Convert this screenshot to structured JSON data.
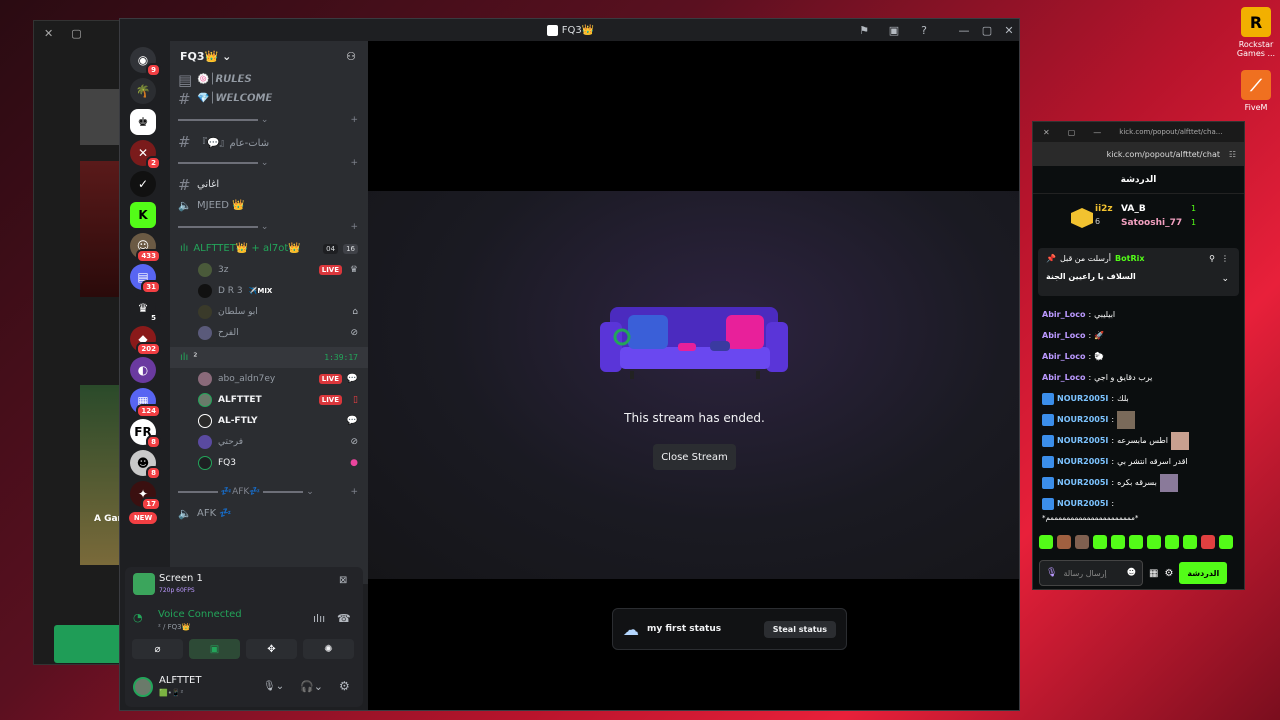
{
  "discord": {
    "window_title": "FQ3👑",
    "server_name": "FQ3👑",
    "guild_badges": [
      "9",
      "",
      "",
      "2",
      "",
      "",
      "433",
      "31",
      "5",
      "202",
      "",
      "124",
      "8",
      "8",
      "17"
    ],
    "new_badge": "NEW",
    "channels_top": [
      {
        "icon": "#",
        "label": "🍥│𝙍𝙐𝙇𝙀𝙎"
      },
      {
        "icon": "#",
        "label": "💎│𝙒𝙀𝙇𝘾𝙊𝙈𝙀"
      }
    ],
    "text_channel_1": "『💬』شات-عام",
    "text_channel_2": "اغاني",
    "voice_channel_mjeed": "MJEED 👑",
    "voice_channel_main": "ALFTTET👑 + al7ot👑",
    "voice_main_counts": [
      "04",
      "16"
    ],
    "voice_main_members": [
      {
        "name": "3z",
        "live": "LIVE"
      },
      {
        "name": "D R 3",
        "tag": "✈️MIX"
      },
      {
        "name": "ابو سلطان"
      },
      {
        "name": "الفرح"
      }
    ],
    "voice_channel_2": "²",
    "voice_2_timer": "1:39:17",
    "voice_2_members": [
      {
        "name": "abo_aldn7ey",
        "live": "LIVE"
      },
      {
        "name": "ALFTTET",
        "live": "LIVE"
      },
      {
        "name": "AL-FTLY"
      },
      {
        "name": "فرحتي"
      },
      {
        "name": "FQ3"
      }
    ],
    "afk_category": "💤AFK💤",
    "afk_channel": "AFK 💤",
    "screen_title": "Screen 1",
    "screen_quality": "720p 60FPS",
    "voice_status": "Voice Connected",
    "voice_location": "² / FQ3👑",
    "username": "ALFTTET",
    "user_status_line": "🟩•📱²",
    "stream_message": "This stream has ended.",
    "close_stream_label": "Close Stream",
    "popup_status": "my first status",
    "steal_status_label": "Steal status"
  },
  "kick": {
    "window_url_short": "kick.com/popout/alfttet/cha...",
    "url": "kick.com/popout/alfttet/chat",
    "header_title": "الدردشة",
    "leaderboard": [
      {
        "name": "ii2z",
        "count": "6"
      },
      {
        "name": "VA_B",
        "count": "1"
      },
      {
        "name": "Satooshi_77",
        "count": "1"
      }
    ],
    "pinned_sender": "BotRix",
    "pinned_prefix": "أرسلت من قبل",
    "pinned_text": "السلاف يا راعيين الجنة",
    "messages": [
      {
        "user": "Abir_Loco",
        "text": "ابيليبي"
      },
      {
        "user": "Abir_Loco",
        "text": "🚀"
      },
      {
        "user": "Abir_Loco",
        "text": "🐑"
      },
      {
        "user": "Abir_Loco",
        "text": "يرب دقايق و اجي"
      },
      {
        "user": "NOUR2005I",
        "text": "بلك"
      },
      {
        "user": "NOUR2005I",
        "text": ""
      },
      {
        "user": "NOUR2005I",
        "text": "اطس مابسرعه"
      },
      {
        "user": "NOUR2005I",
        "text": "اقدر اسرقه انتشر بي"
      },
      {
        "user": "NOUR2005I",
        "text": "بسرقه بكره"
      },
      {
        "user": "NOUR2005I",
        "text": ""
      }
    ],
    "spam_line": "*مممممممممممممممممممممم*",
    "input_placeholder": "إرسال رسالة",
    "send_label": "الدردشة"
  },
  "desktop": {
    "rockstar_label": "Rockstar Games ...",
    "fivem_label": "FiveM"
  },
  "background_window": {
    "caption": "A Gar"
  }
}
